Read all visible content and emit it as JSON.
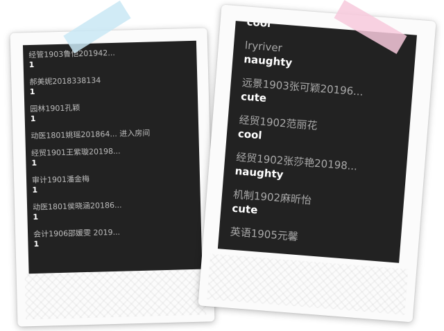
{
  "left_card": {
    "items": [
      {
        "name": "经管1903鲁恺201942...",
        "value": "1"
      },
      {
        "name": "郝美妮2018338134",
        "value": "1"
      },
      {
        "name": "园林1901孔颖",
        "value": "1"
      },
      {
        "name": "动医1801姚瑶201864... 进入房间",
        "value": ""
      },
      {
        "name": "经贸1901王紫璇20198...",
        "value": "1"
      },
      {
        "name": "审计1901潘金梅",
        "value": "1"
      },
      {
        "name": "动医1801侯晓涵20186...",
        "value": "1"
      },
      {
        "name": "会计1906邵媛雯 2019...",
        "value": "1"
      }
    ]
  },
  "right_card": {
    "items": [
      {
        "name": "",
        "value": "cool"
      },
      {
        "name": "lryriver",
        "value": "naughty"
      },
      {
        "name": "远景1903张可颖20196...",
        "value": "cute"
      },
      {
        "name": "经贸1902范丽花",
        "value": "cool"
      },
      {
        "name": "经贸1902张莎艳20198...",
        "value": "naughty"
      },
      {
        "name": "机制1902麻昕怡",
        "value": "cute"
      },
      {
        "name": "英语1905元馨",
        "value": ""
      }
    ]
  },
  "tapes": {
    "left_color": "#c9e8f5",
    "right_color": "#f7c9dc"
  }
}
